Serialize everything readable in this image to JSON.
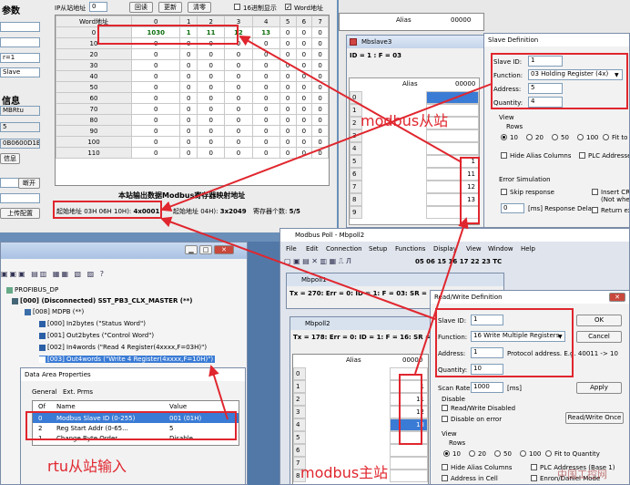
{
  "colors": {
    "annotation": "#e0262e",
    "selected_blue": "#3a7bd5"
  },
  "config": {
    "section_params": "参数",
    "section_info": "信息",
    "left_fields": [
      "",
      "",
      "r=1",
      "Slave",
      ""
    ],
    "info_fields": [
      "MBRtu",
      "5",
      "0B0600D1B6557"
    ],
    "info_btn": "信息",
    "btn_open": "断开",
    "btn_upload": "上传配置",
    "ip_label": "IP从站地址",
    "ip_value": "0",
    "btn_read": "回读",
    "btn_update": "更新",
    "btn_clear": "清零",
    "hex_label": "16进制显示",
    "word_label": "Word地址",
    "grid_cols": [
      "Word地址",
      "0",
      "1",
      "2",
      "3",
      "4",
      "5",
      "6",
      "7"
    ],
    "grid_rows": [
      [
        "0",
        "1030",
        "1",
        "11",
        "12",
        "13",
        "0",
        "0",
        "0"
      ],
      [
        "10",
        "0",
        "0",
        "0",
        "0",
        "0",
        "0",
        "0",
        "0"
      ],
      [
        "20",
        "0",
        "0",
        "0",
        "0",
        "0",
        "0",
        "0",
        "0"
      ],
      [
        "30",
        "0",
        "0",
        "0",
        "0",
        "0",
        "0",
        "0",
        "0"
      ],
      [
        "40",
        "0",
        "0",
        "0",
        "0",
        "0",
        "0",
        "0",
        "0"
      ],
      [
        "50",
        "0",
        "0",
        "0",
        "0",
        "0",
        "0",
        "0",
        "0"
      ],
      [
        "60",
        "0",
        "0",
        "0",
        "0",
        "0",
        "0",
        "0",
        "0"
      ],
      [
        "70",
        "0",
        "0",
        "0",
        "0",
        "0",
        "0",
        "0",
        "0"
      ],
      [
        "80",
        "0",
        "0",
        "0",
        "0",
        "0",
        "0",
        "0",
        "0"
      ],
      [
        "90",
        "0",
        "0",
        "0",
        "0",
        "0",
        "0",
        "0",
        "0"
      ],
      [
        "100",
        "0",
        "0",
        "0",
        "0",
        "0",
        "0",
        "0",
        "0"
      ],
      [
        "110",
        "0",
        "0",
        "0",
        "0",
        "0",
        "0",
        "0",
        "0"
      ]
    ],
    "mapping_title": "本站输出数据Modbus寄存器映射地址",
    "start_addr_label": "起始地址 03H 06H 10H): ",
    "start_addr_value": "4x0001",
    "start_addr2_label": "起始地址 04H): ",
    "start_addr2_value": "3x2049",
    "reg_count_label": "寄存器个数:",
    "reg_count_value": "5/5"
  },
  "slave_top": {
    "alias": "Alias",
    "value": "00000"
  },
  "mbslave": {
    "title": "Mbslave3",
    "status": "ID = 1 : F = 03",
    "alias": "Alias",
    "col": "00000",
    "rows": [
      "0",
      "1",
      "2",
      "3",
      "4",
      "5",
      "6",
      "7",
      "8",
      "9"
    ],
    "values": [
      "",
      "",
      "",
      "",
      "",
      "1",
      "11",
      "12",
      "13",
      ""
    ]
  },
  "slave_def": {
    "title": "Slave Definition",
    "slave_id_label": "Slave ID:",
    "slave_id": "1",
    "function_label": "Function:",
    "function": "03 Holding Register (4x)",
    "address_label": "Address:",
    "address": "5",
    "quantity_label": "Quantity:",
    "quantity": "4",
    "view_label": "View",
    "rows_label": "Rows",
    "rows_opts": [
      "10",
      "20",
      "50",
      "100",
      "Fit to Q"
    ],
    "hide_alias": "Hide Alias Columns",
    "plc_addr": "PLC Addresses (",
    "err_sim": "Error Simulation",
    "skip_resp": "Skip response",
    "insert_crc": "Insert CRC",
    "not_when": "(Not when",
    "resp_delay_value": "0",
    "resp_delay_label": "[ms] Response Delay",
    "return_exc": "Return exc"
  },
  "mpoll": {
    "title": "Modbus Poll - Mbpoll2",
    "menu": [
      "File",
      "Edit",
      "Connection",
      "Setup",
      "Functions",
      "Display",
      "View",
      "Window",
      "Help"
    ],
    "toolbar_codes": "05 06 15 16 17 22 23 TC",
    "mbpoll1": "Mbpoll1",
    "status1": "Tx = 270: Err = 0: ID = 1: F = 03: SR = ",
    "mbpoll2": "Mbpoll2",
    "status2": "Tx = 178: Err = 0: ID = 1: F = 16: SR = ",
    "alias": "Alias",
    "col": "00000",
    "rows": [
      "0",
      "1",
      "2",
      "3",
      "4",
      "5",
      "6",
      "7",
      "8"
    ],
    "values": [
      "",
      "1",
      "11",
      "12",
      "13",
      "",
      "",
      "",
      ""
    ]
  },
  "rw_def": {
    "title": "Read/Write Definition",
    "slave_id_label": "Slave ID:",
    "slave_id": "1",
    "function_label": "Function:",
    "function": "16 Write Multiple Registers",
    "address_label": "Address:",
    "address": "1",
    "protocol_note": "Protocol address. E.g. 40011 -> 10",
    "quantity_label": "Quantity:",
    "quantity": "10",
    "scan_label": "Scan Rate:",
    "scan": "1000",
    "scan_unit": "[ms]",
    "disable_label": "Disable",
    "rw_disabled": "Read/Write Disabled",
    "disable_err": "Disable on error",
    "rw_once": "Read/Write Once",
    "ok": "OK",
    "cancel": "Cancel",
    "apply": "Apply",
    "view_label": "View",
    "rows_label": "Rows",
    "rows_opts": [
      "10",
      "20",
      "50",
      "100",
      "Fit to Quantity"
    ],
    "hide_alias": "Hide Alias Columns",
    "plc_addr": "PLC Addresses (Base 1)",
    "addr_cell": "Address in Cell",
    "enron": "Enron/Daniel Mode"
  },
  "profibus": {
    "root": "PROFIBUS_DP",
    "master": "[000] (Disconnected) SST_PB3_CLX_MASTER (**)",
    "slave": "[008] MDPB (**)",
    "modules": [
      "[000] In2bytes (\"Status Word\")",
      "[001] Out2bytes (\"Control Word\")",
      "[002] In4words (\"Read 4 Register(4xxxx,F=03H)\")",
      "[003] Out4words (\"Write 4 Register(4xxxx,F=10H)\")"
    ]
  },
  "data_area": {
    "title": "Data Area Properties",
    "tabs": [
      "General",
      "Ext. Prms"
    ],
    "headers": [
      "Of",
      "Name",
      "Value"
    ],
    "rows": [
      [
        "0",
        "Modbus Slave ID (0-255)",
        "001 (01H)"
      ],
      [
        "2",
        "Reg Start Addr (0-65...",
        "5"
      ],
      [
        "1",
        "Change Byte Order",
        "Disable"
      ]
    ]
  },
  "annotations": {
    "slave": "modbus从站",
    "master": "modbus主站",
    "rtu": "rtu从站输入"
  },
  "watermark": "中国工控网"
}
